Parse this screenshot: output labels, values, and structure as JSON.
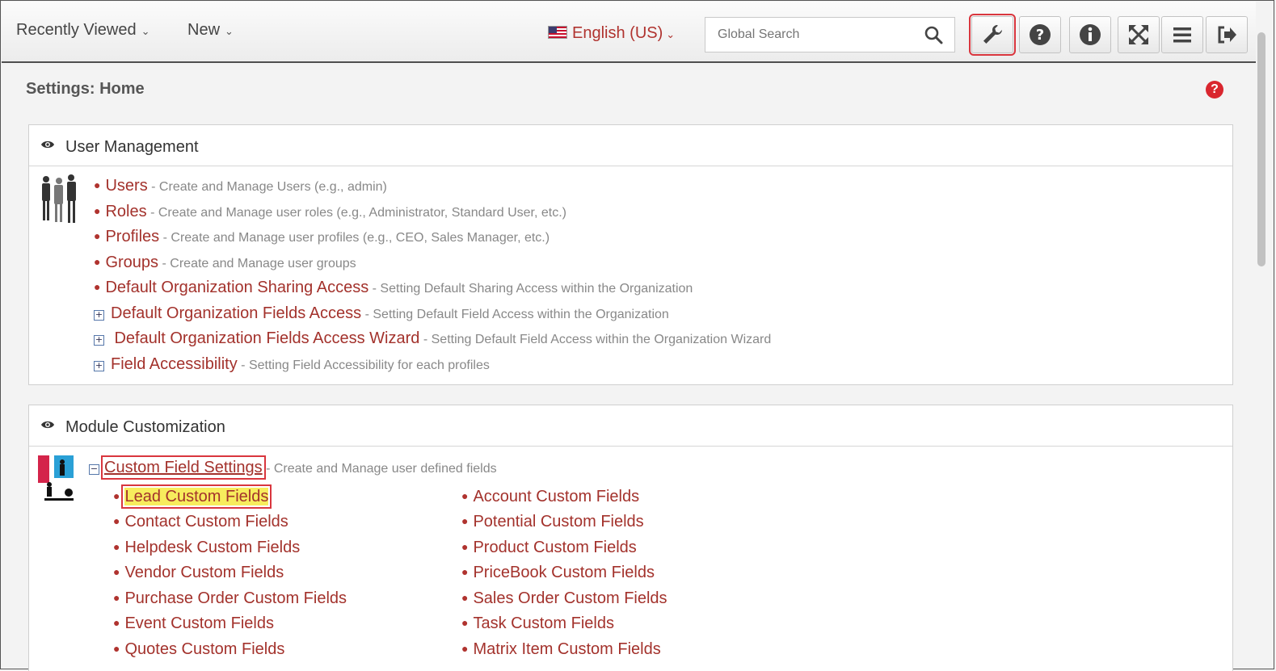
{
  "topbar": {
    "recently_viewed": "Recently Viewed",
    "new": "New",
    "language": "English (US)",
    "search_placeholder": "Global Search"
  },
  "page": {
    "title": "Settings: Home"
  },
  "user_management": {
    "title": "User Management",
    "items": [
      {
        "label": "Users",
        "desc": "- Create and Manage Users (e.g., admin)"
      },
      {
        "label": "Roles",
        "desc": "- Create and Manage user roles (e.g., Administrator, Standard User, etc.)"
      },
      {
        "label": "Profiles",
        "desc": "- Create and Manage user profiles (e.g., CEO, Sales Manager, etc.)"
      },
      {
        "label": "Groups",
        "desc": "- Create and Manage user groups"
      },
      {
        "label": "Default Organization Sharing Access",
        "desc": "- Setting Default Sharing Access within the Organization"
      },
      {
        "label": "Default Organization Fields Access",
        "desc": "- Setting Default Field Access within the Organization"
      },
      {
        "label": "Default Organization Fields Access Wizard",
        "desc": "- Setting Default Field Access within the Organization Wizard"
      },
      {
        "label": "Field Accessibility",
        "desc": "- Setting Field Accessibility for each profiles"
      }
    ]
  },
  "module_customization": {
    "title": "Module Customization",
    "custom_field_settings": {
      "label": "Custom Field Settings",
      "desc": "- Create and Manage user defined fields"
    },
    "left": [
      "Lead Custom Fields",
      "Contact Custom Fields",
      "Helpdesk Custom Fields",
      "Vendor Custom Fields",
      "Purchase Order Custom Fields",
      "Event Custom Fields",
      "Quotes Custom Fields"
    ],
    "right": [
      "Account Custom Fields",
      "Potential Custom Fields",
      "Product Custom Fields",
      "PriceBook Custom Fields",
      "Sales Order Custom Fields",
      "Task Custom Fields",
      "Matrix Item Custom Fields"
    ]
  },
  "colors": {
    "link": "#a3322c",
    "highlight_box": "#d9363e",
    "highlight_fill": "#f7ec5d"
  }
}
